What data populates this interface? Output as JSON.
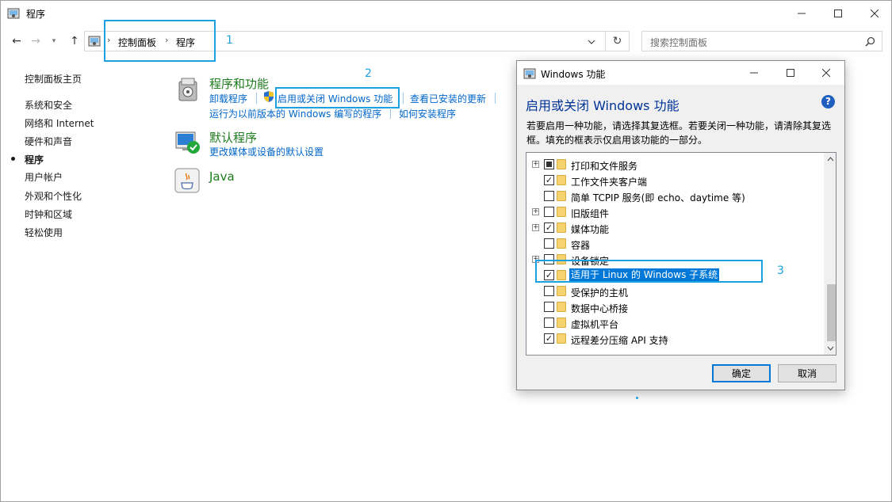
{
  "window": {
    "title": "程序"
  },
  "address": {
    "breadcrumbs": [
      "控制面板",
      "程序"
    ],
    "search_placeholder": "搜索控制面板"
  },
  "annotations": [
    "1",
    "2",
    "3"
  ],
  "sidebar": {
    "items": [
      "控制面板主页",
      "系统和安全",
      "网络和 Internet",
      "硬件和声音",
      "程序",
      "用户帐户",
      "外观和个性化",
      "时钟和区域",
      "轻松使用"
    ],
    "active_index": 4
  },
  "main": {
    "programs": {
      "title": "程序和功能",
      "links": [
        "卸载程序",
        "启用或关闭 Windows 功能",
        "查看已安装的更新",
        "运行为以前版本的 Windows 编写的程序",
        "如何安装程序"
      ]
    },
    "defaults": {
      "title": "默认程序",
      "link": "更改媒体或设备的默认设置"
    },
    "java": {
      "title": "Java"
    }
  },
  "dialog": {
    "title": "Windows 功能",
    "heading": "启用或关闭 Windows 功能",
    "description": "若要启用一种功能，请选择其复选框。若要关闭一种功能，请清除其复选框。填充的框表示仅启用该功能的一部分。",
    "features": [
      {
        "label": "打印和文件服务",
        "expandable": true,
        "state": "partial"
      },
      {
        "label": "工作文件夹客户端",
        "expandable": false,
        "state": "checked"
      },
      {
        "label": "简单 TCPIP 服务(即 echo、daytime 等)",
        "expandable": false,
        "state": "unchecked"
      },
      {
        "label": "旧版组件",
        "expandable": true,
        "state": "unchecked"
      },
      {
        "label": "媒体功能",
        "expandable": true,
        "state": "checked"
      },
      {
        "label": "容器",
        "expandable": false,
        "state": "unchecked"
      },
      {
        "label": "设备锁定",
        "expandable": true,
        "state": "unchecked"
      },
      {
        "label": "适用于 Linux 的 Windows 子系统",
        "expandable": false,
        "state": "checked",
        "selected": true
      },
      {
        "label": "受保护的主机",
        "expandable": false,
        "state": "unchecked"
      },
      {
        "label": "数据中心桥接",
        "expandable": false,
        "state": "unchecked"
      },
      {
        "label": "虚拟机平台",
        "expandable": false,
        "state": "unchecked"
      },
      {
        "label": "远程差分压缩 API 支持",
        "expandable": false,
        "state": "checked"
      }
    ],
    "ok_label": "确定",
    "cancel_label": "取消"
  },
  "colors": {
    "accent": "#1ba1e2",
    "link": "#0066cc",
    "heading_green": "#1e7c1e",
    "selection": "#0078d7"
  }
}
